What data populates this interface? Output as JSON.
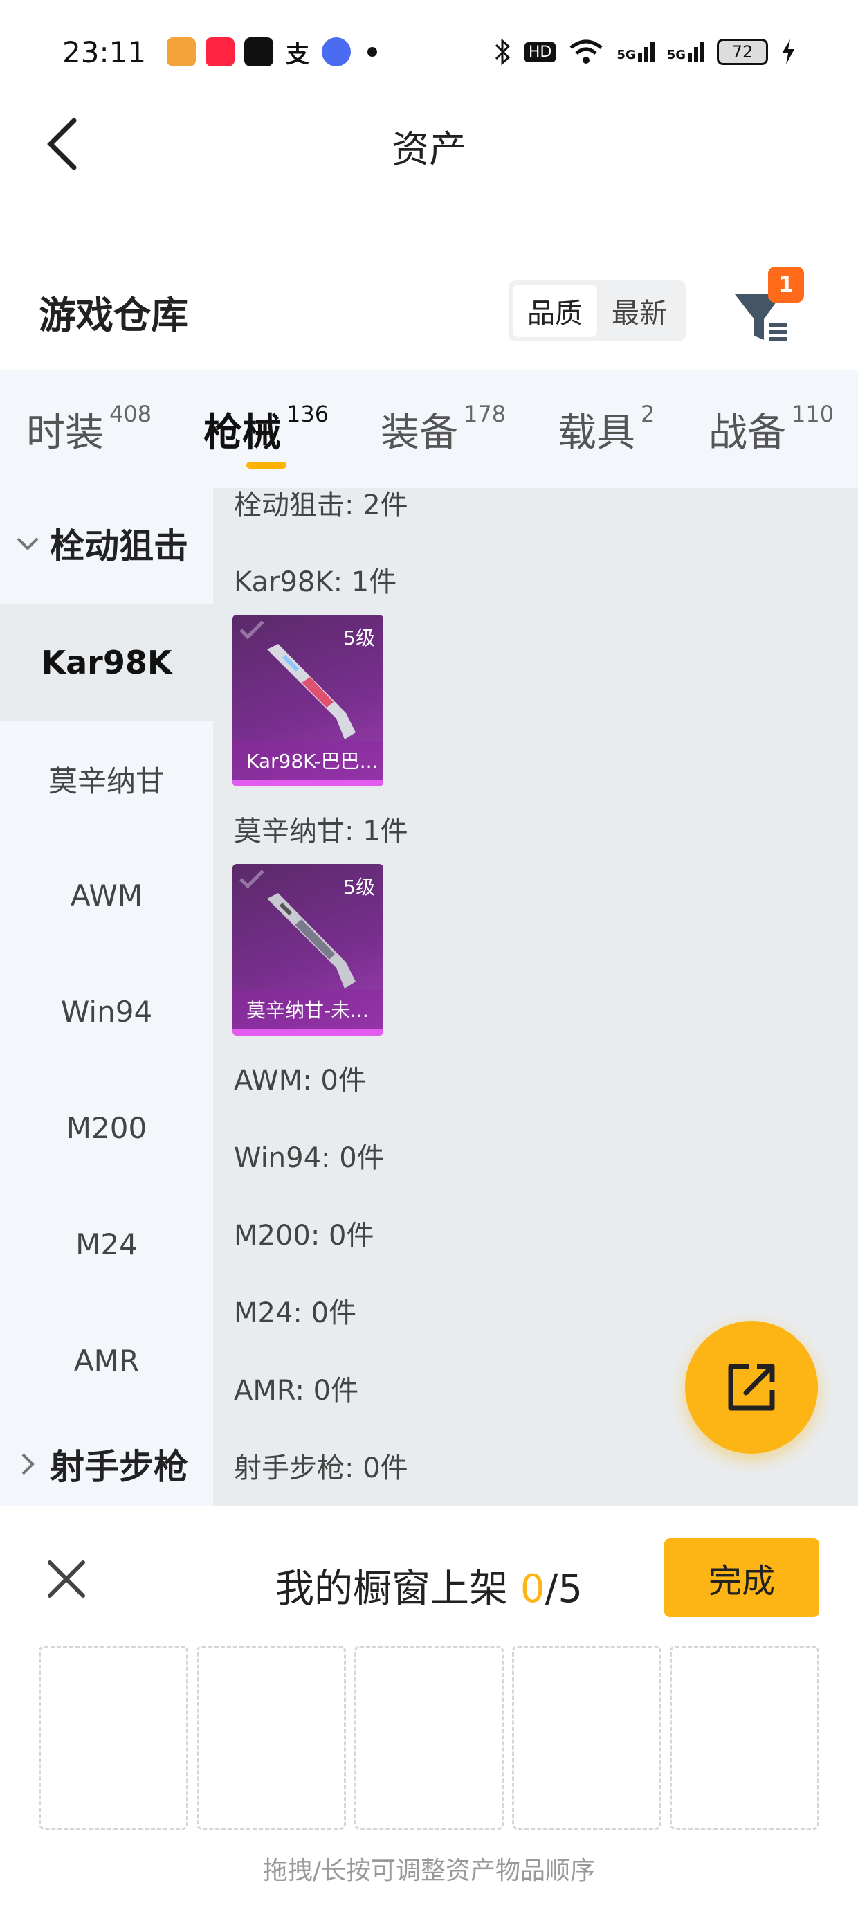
{
  "status_bar": {
    "time": "23:11",
    "apps": [
      "fanqie",
      "xiaohongshu",
      "douyin",
      "alipay",
      "tieba"
    ],
    "network_hd": "HD",
    "signal1": "5G",
    "signal2": "5G",
    "battery": "72"
  },
  "header": {
    "title": "资产"
  },
  "warehouse": {
    "title": "游戏仓库",
    "sort_options": [
      "品质",
      "最新"
    ],
    "active_sort": "品质",
    "filter_badge": "1"
  },
  "tabs": [
    {
      "label": "时装",
      "count": "408"
    },
    {
      "label": "枪械",
      "count": "136",
      "active": true
    },
    {
      "label": "装备",
      "count": "178"
    },
    {
      "label": "载具",
      "count": "2"
    },
    {
      "label": "战备",
      "count": "110"
    }
  ],
  "sidebar": {
    "groups": [
      {
        "label": "栓动狙击",
        "expanded": true
      },
      {
        "label": "射手步枪",
        "expanded": false
      }
    ],
    "items": [
      "Kar98K",
      "莫辛纳甘",
      "AWM",
      "Win94",
      "M200",
      "M24",
      "AMR"
    ],
    "active_item": "Kar98K"
  },
  "content": {
    "group_header": "栓动狙击: 2件",
    "sections": [
      {
        "label": "Kar98K: 1件",
        "card": {
          "level": "5级",
          "name": "Kar98K-巴巴..."
        }
      },
      {
        "label": "莫辛纳甘: 1件",
        "card": {
          "level": "5级",
          "name": "莫辛纳甘-未..."
        }
      },
      {
        "label": "AWM: 0件"
      },
      {
        "label": "Win94: 0件"
      },
      {
        "label": "M200: 0件"
      },
      {
        "label": "M24: 0件"
      },
      {
        "label": "AMR: 0件"
      },
      {
        "label": "射手步枪: 0件"
      }
    ]
  },
  "showcase": {
    "title_prefix": "我的橱窗上架 ",
    "current": "0",
    "total": "/5",
    "done_label": "完成",
    "slot_count": 5,
    "hint": "拖拽/长按可调整资产物品顺序"
  },
  "colors": {
    "accent": "#fdb515",
    "badge": "#ff6b1a",
    "rarity": "#9b3fb0"
  }
}
